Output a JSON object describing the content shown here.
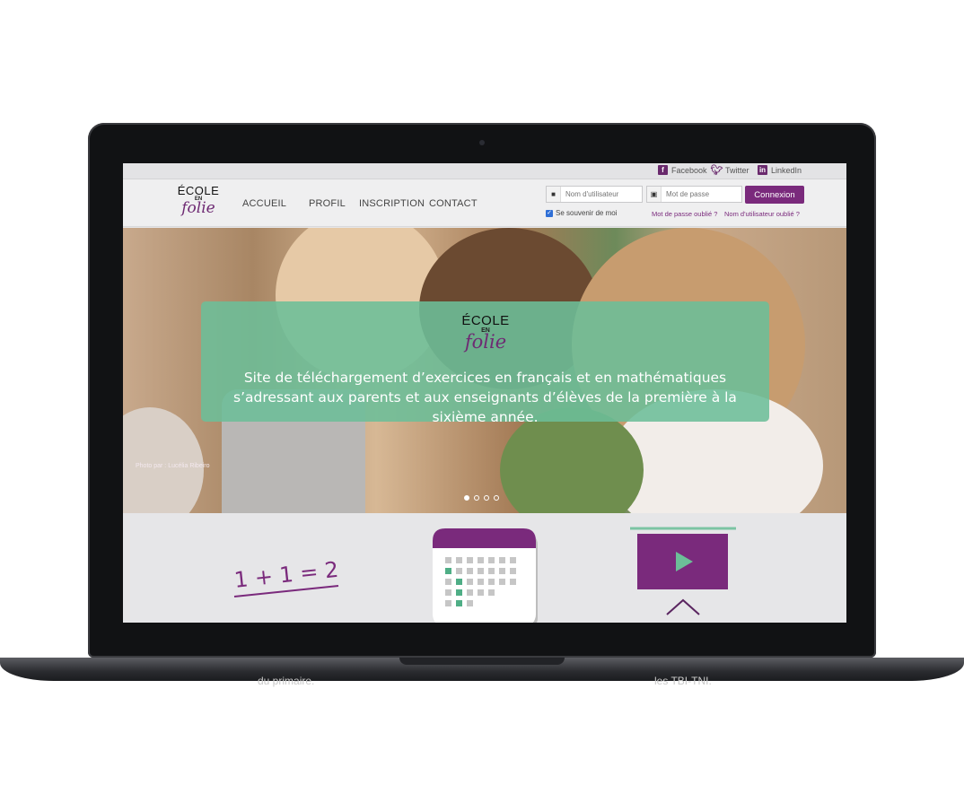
{
  "social": {
    "facebook": "Facebook",
    "twitter": "Twitter",
    "linkedin": "LinkedIn"
  },
  "logo": {
    "line1": "ÉCOLE",
    "en": "EN",
    "line2": "folie"
  },
  "nav": {
    "items": [
      "ACCUEIL",
      "PROFIL",
      "INSCRIPTION",
      "CONTACT"
    ]
  },
  "login": {
    "username_placeholder": "Nom d'utilisateur",
    "password_placeholder": "Mot de passe",
    "button": "Connexion",
    "remember": "Se souvenir de moi",
    "forgot_password": "Mot de passe oublié ?",
    "forgot_username": "Nom d'utilisateur oublié ?"
  },
  "hero": {
    "caption": "Site de téléchargement d’exercices en français et en mathématiques s’adressant aux parents et aux enseignants d’élèves de la première à la sixième année.",
    "photo_credit": "Photo par : Lucélia Ribeiro",
    "slides": 4,
    "active_slide": 1
  },
  "features": {
    "math_text": "1 + 1 = 2"
  },
  "below": {
    "left": "du primaire.",
    "right": "les TBI-TNI."
  },
  "colors": {
    "brand_purple": "#7a2a7c",
    "caption_green": "#6cbe98",
    "calendar_green": "#4fae86"
  }
}
